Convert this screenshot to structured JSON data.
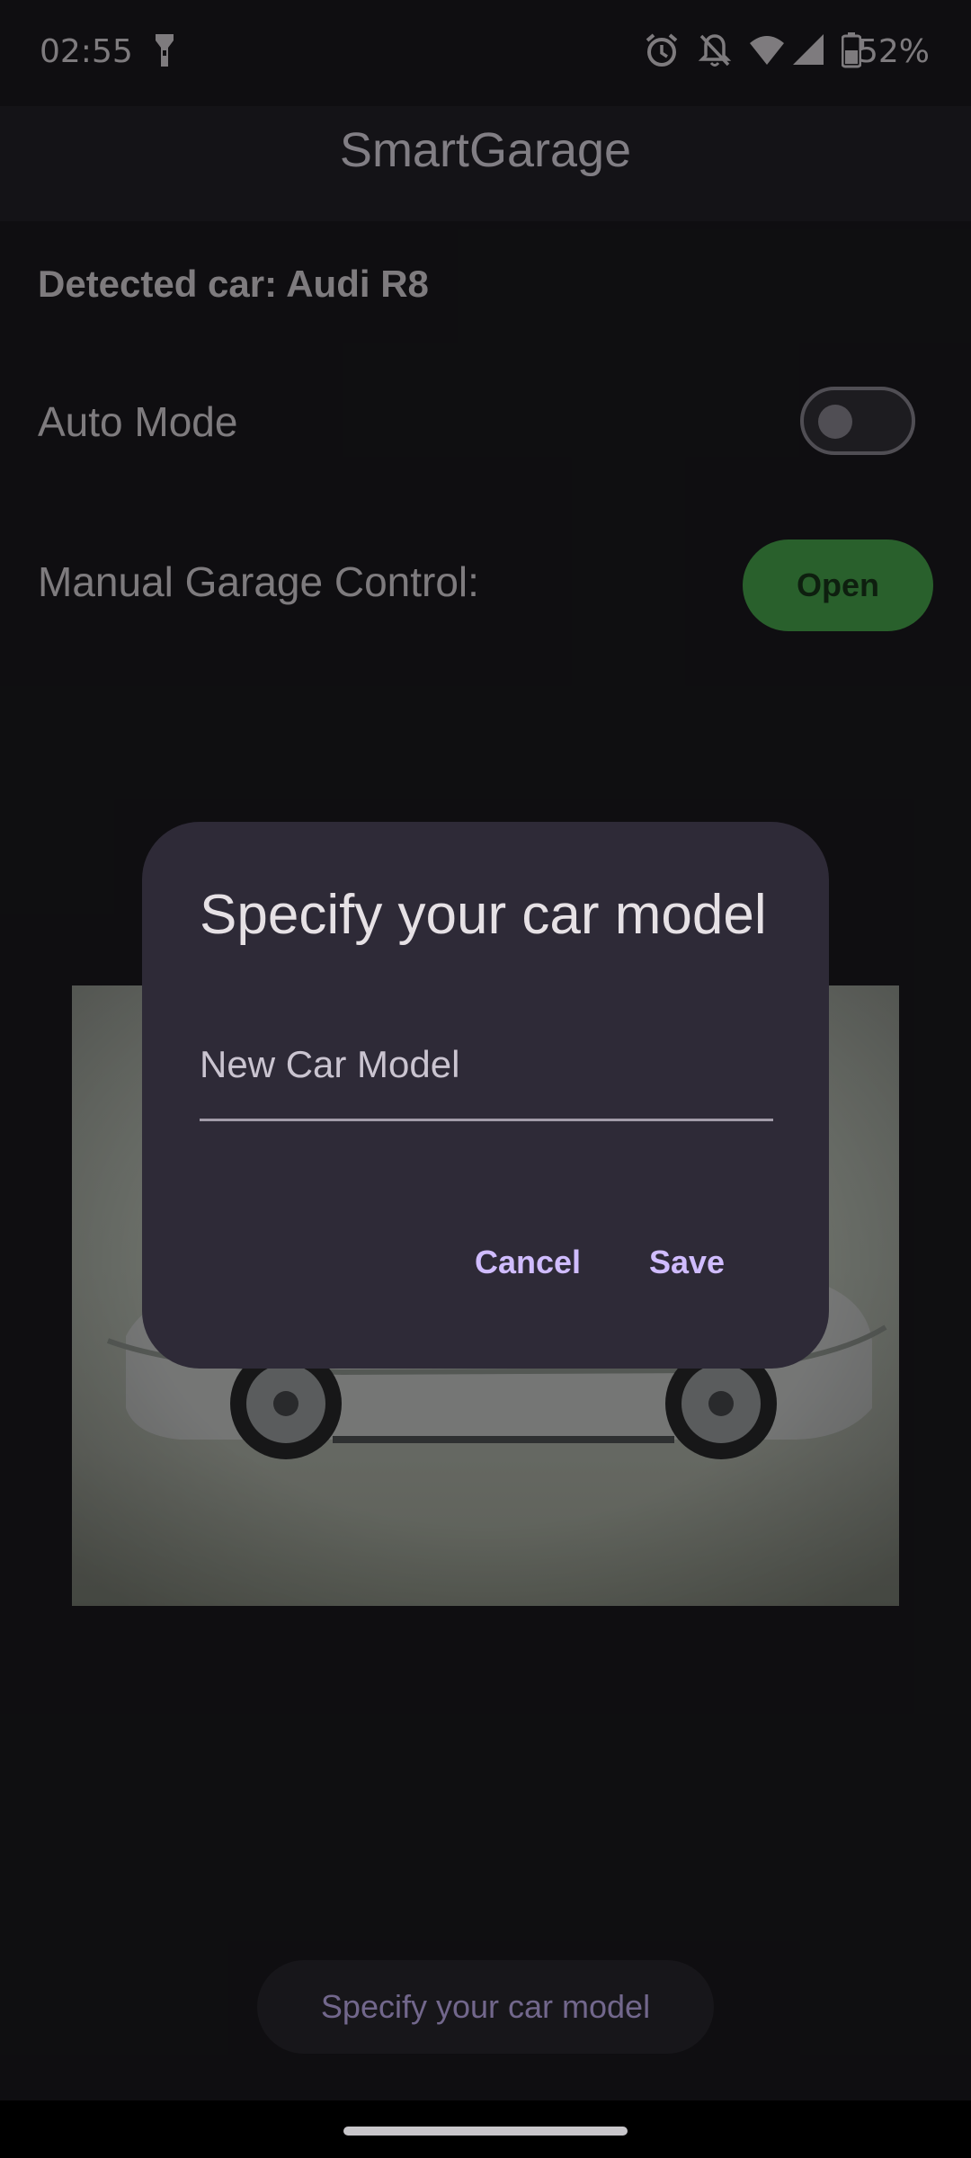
{
  "status_bar": {
    "time": "02:55",
    "battery_percent": "52%",
    "icons": [
      "flashlight-icon",
      "alarm-icon",
      "notifications-off-icon",
      "wifi-icon",
      "cellular-signal-icon",
      "battery-icon"
    ]
  },
  "app_bar": {
    "title": "SmartGarage"
  },
  "main": {
    "detected_car": "Detected car: Audi R8",
    "auto_mode_label": "Auto Mode",
    "auto_mode_on": false,
    "manual_control_label": "Manual Garage Control:",
    "open_button": "Open",
    "specify_button": "Specify your car model"
  },
  "dialog": {
    "title": "Specify your car model",
    "input_placeholder": "New Car Model",
    "input_value": "",
    "cancel": "Cancel",
    "save": "Save"
  },
  "colors": {
    "accent": "#d0bcff",
    "open_button": "#4caf50",
    "background": "#1c1b1f",
    "dialog": "#2e2a37"
  }
}
